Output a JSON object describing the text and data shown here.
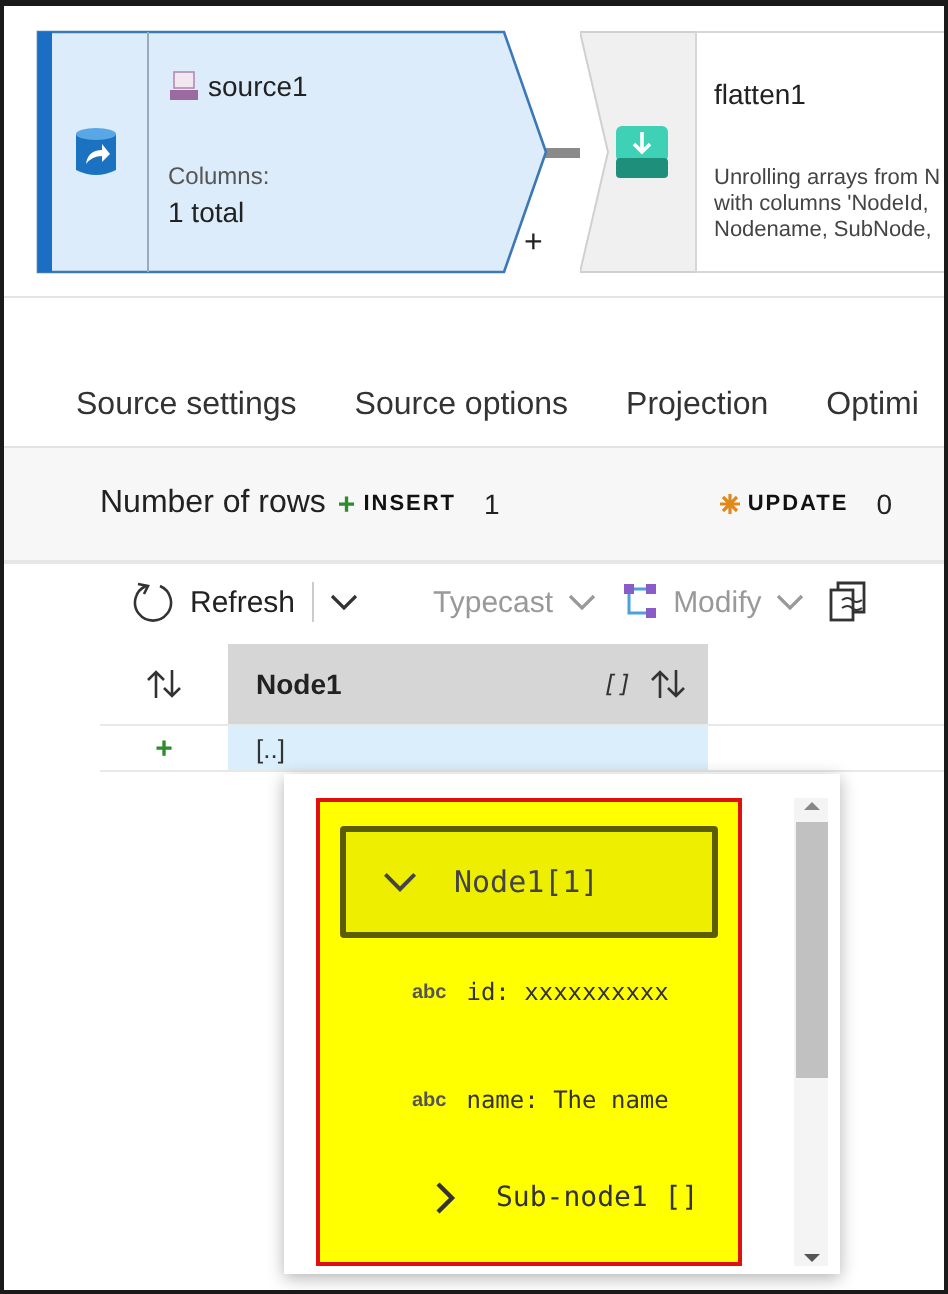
{
  "canvas": {
    "nodes": [
      {
        "kind": "source",
        "title": "source1",
        "columns_label": "Columns:",
        "columns_value": "1 total",
        "selected": true
      },
      {
        "kind": "flatten",
        "title": "flatten1",
        "description_lines": [
          "Unrolling arrays from N",
          "with columns 'NodeId,",
          "Nodename, SubNode,"
        ],
        "selected": false
      }
    ],
    "add_symbol": "+"
  },
  "tabs": [
    {
      "label": "Source settings",
      "selected": false
    },
    {
      "label": "Source options",
      "selected": false
    },
    {
      "label": "Projection",
      "selected": false
    },
    {
      "label": "Optimi",
      "selected": false
    }
  ],
  "stats": {
    "label": "Number of rows",
    "insert": {
      "symbol": "+",
      "label": "INSERT",
      "value": "1"
    },
    "update": {
      "label": "UPDATE",
      "value": "0"
    }
  },
  "toolbar": [
    {
      "kind": "refresh",
      "label": "Refresh",
      "disabled": false
    },
    {
      "kind": "split",
      "disabled": false
    },
    {
      "kind": "typecast",
      "label": "Typecast",
      "disabled": true
    },
    {
      "kind": "modify",
      "label": "Modify",
      "disabled": true
    },
    {
      "kind": "export",
      "disabled": false
    }
  ],
  "grid": {
    "columns": [
      {
        "name": "Node1",
        "type": "[]"
      }
    ],
    "rows": [
      {
        "marker": "+",
        "cells": [
          "[..]"
        ],
        "selected": true
      }
    ]
  },
  "popup": {
    "header": {
      "label": "Node1[1]",
      "expanded": true
    },
    "items": [
      {
        "kind": "field",
        "type": "abc",
        "text": "id: xxxxxxxxxx"
      },
      {
        "kind": "field",
        "type": "abc",
        "text": "name: The name"
      },
      {
        "kind": "array",
        "text": "Sub-node1 []",
        "expanded": false
      }
    ]
  }
}
